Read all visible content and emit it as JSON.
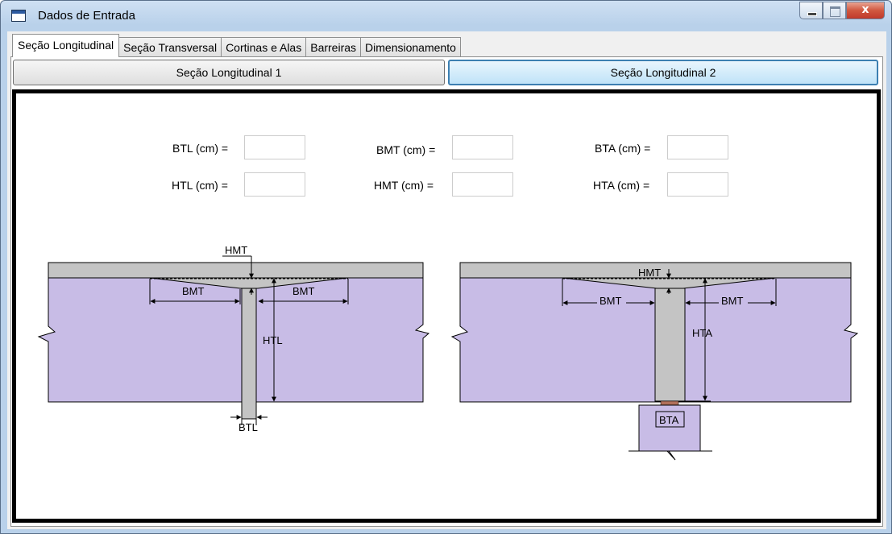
{
  "window": {
    "title": "Dados de Entrada",
    "close_glyph": "x"
  },
  "tabs": [
    "Seção Longitudinal",
    "Seção Transversal",
    "Cortinas e Alas",
    "Barreiras",
    "Dimensionamento"
  ],
  "subtabs": [
    "Seção Longitudinal 1",
    "Seção Longitudinal 2"
  ],
  "fields": {
    "btl": {
      "label": "BTL (cm) =",
      "value": ""
    },
    "htl": {
      "label": "HTL (cm) =",
      "value": ""
    },
    "bmt": {
      "label": "BMT (cm) =",
      "value": ""
    },
    "hmt": {
      "label": "HMT (cm) =",
      "value": ""
    },
    "bta": {
      "label": "BTA (cm) =",
      "value": ""
    },
    "hta": {
      "label": "HTA (cm) =",
      "value": ""
    }
  },
  "diagram1": {
    "hmt": "HMT",
    "bmt_left": "BMT",
    "bmt_right": "BMT",
    "htl": "HTL",
    "btl": "BTL"
  },
  "diagram2": {
    "hmt": "HMT",
    "bmt_left": "BMT",
    "bmt_right": "BMT",
    "hta": "HTA",
    "bta": "BTA"
  },
  "colors": {
    "slab": "#c4c4c4",
    "soil": "#c8bce6",
    "beam": "#c4c4c4",
    "bearing": "#b0705a"
  }
}
